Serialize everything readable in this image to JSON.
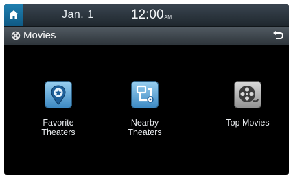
{
  "status": {
    "date": "Jan.  1",
    "time": "12:00",
    "ampm": "AM"
  },
  "header": {
    "title": "Movies",
    "title_icon": "film-reel-icon",
    "back_icon": "back-arrow-icon",
    "home_icon": "home-icon"
  },
  "menu": {
    "items": [
      {
        "line1": "Favorite",
        "line2": "Theaters",
        "icon": "location-star-icon"
      },
      {
        "line1": "Nearby",
        "line2": "Theaters",
        "icon": "route-icon"
      },
      {
        "line1": "Top Movies",
        "line2": "",
        "icon": "film-reel-icon"
      }
    ]
  },
  "colors": {
    "screen_bg": "#000000",
    "home_button": "#1f7fb0",
    "tile_blue": "#3b88c2",
    "tile_gray": "#8f8f8f"
  }
}
